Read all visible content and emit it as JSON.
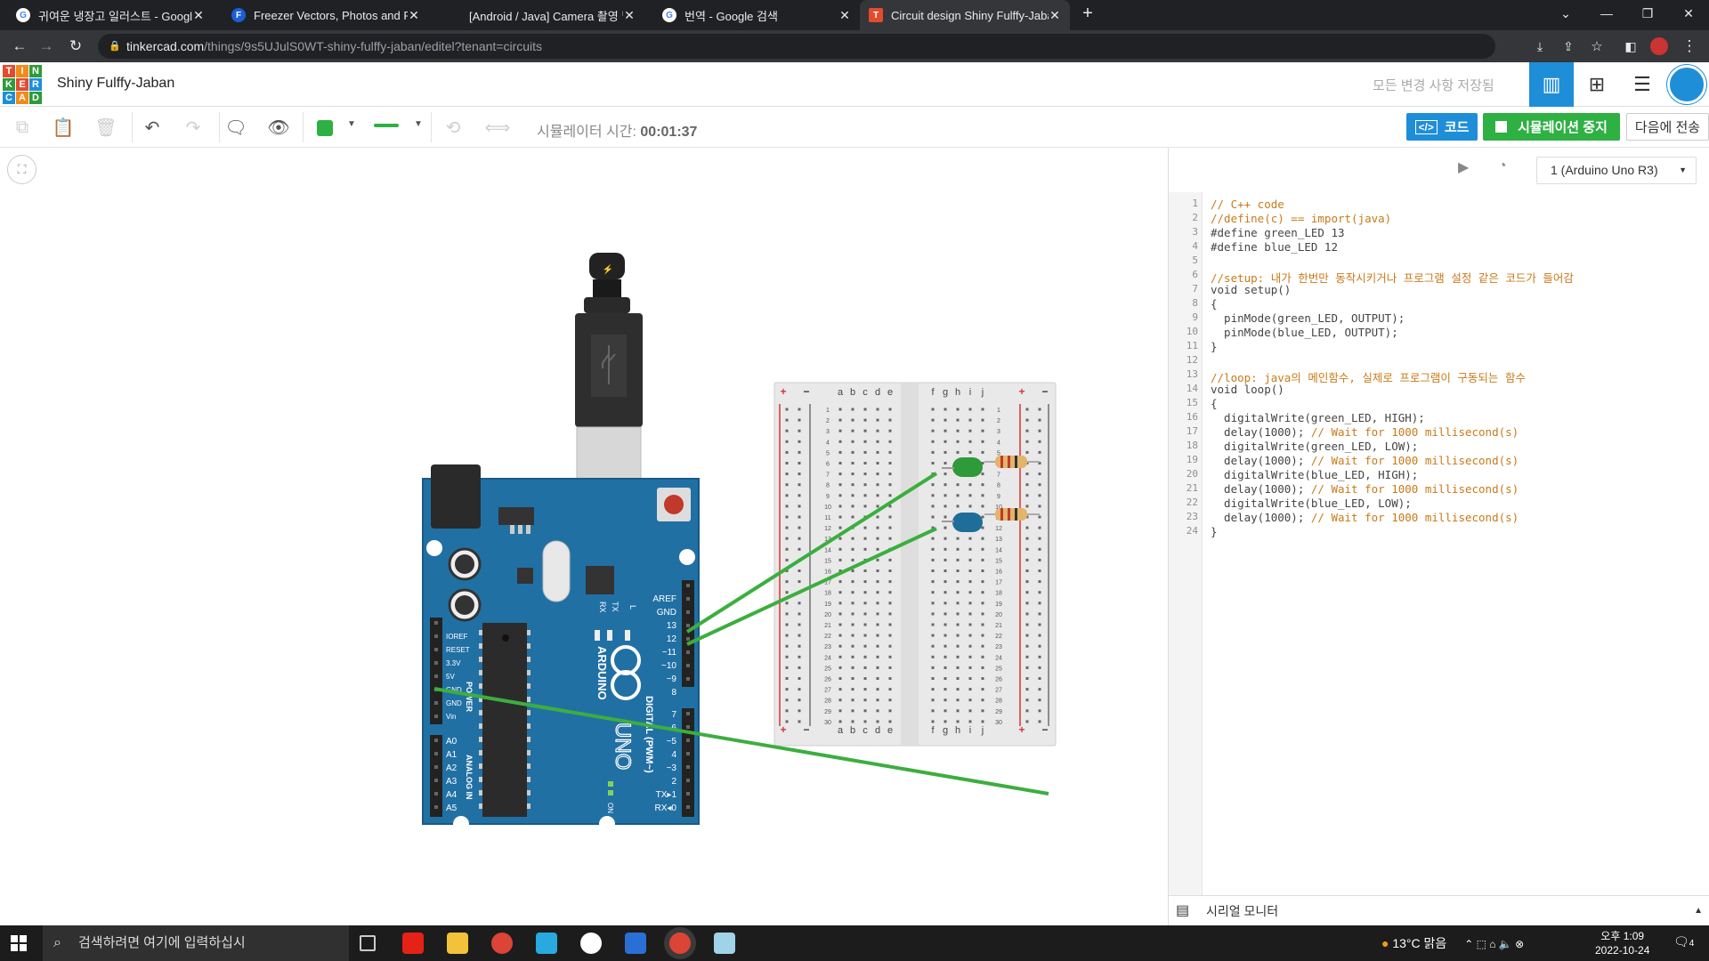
{
  "browser": {
    "tabs": [
      {
        "title": "귀여운 냉장고 일러스트 - Google",
        "icon": "google-icon",
        "active": false
      },
      {
        "title": "Freezer Vectors, Photos and PSD",
        "icon": "freepik-icon",
        "active": false
      },
      {
        "title": "[Android / Java] Camera 촬영 및",
        "icon": "blank-icon",
        "active": false
      },
      {
        "title": "번역 - Google 검색",
        "icon": "google-icon",
        "active": false
      },
      {
        "title": "Circuit design Shiny Fulffy-Jaban",
        "icon": "tinkercad-icon",
        "active": true
      }
    ],
    "url_host": "tinkercad.com",
    "url_path": "/things/9s5UJulS0WT-shiny-fulffy-jaban/editel?tenant=circuits"
  },
  "app": {
    "logo_letters": [
      "T",
      "I",
      "N",
      "K",
      "E",
      "R",
      "C",
      "A",
      "D"
    ],
    "design_name": "Shiny Fulffy-Jaban",
    "save_status": "모든 변경 사항 저장됨"
  },
  "toolbar": {
    "sim_time_label": "시뮬레이터 시간:",
    "sim_time_value": "00:01:37",
    "code_button": "코드",
    "stop_button": "시뮬레이션 중지",
    "send_button": "다음에 전송",
    "color_selected": "#2eb043"
  },
  "code_panel": {
    "device_select": "1 (Arduino Uno R3)",
    "serial_monitor": "시리얼 모니터",
    "lines": [
      "// C++ code",
      "//define(c) == import(java)",
      "#define green_LED 13",
      "#define blue_LED 12",
      "",
      "//setup: 내가 한번만 동작시키거나 프로그램 설정 같은 코드가 들어감",
      "void setup()",
      "{",
      "  pinMode(green_LED, OUTPUT);",
      "  pinMode(blue_LED, OUTPUT);",
      "}",
      "",
      "//loop: java의 메인함수, 실제로 프로그램이 구동되는 함수",
      "void loop()",
      "{",
      "  digitalWrite(green_LED, HIGH);",
      "  delay(1000); // Wait for 1000 millisecond(s)",
      "  digitalWrite(green_LED, LOW);",
      "  delay(1000); // Wait for 1000 millisecond(s)",
      "  digitalWrite(blue_LED, HIGH);",
      "  delay(1000); // Wait for 1000 millisecond(s)",
      "  digitalWrite(blue_LED, LOW);",
      "  delay(1000); // Wait for 1000 millisecond(s)",
      "}"
    ]
  },
  "circuit": {
    "board_brand": "ARDUINO",
    "board_model": "UNO",
    "digital_label": "DIGITAL (PWM~)",
    "power_label": "POWER",
    "analog_label": "ANALOG IN",
    "on_label": "ON",
    "tx_label": "TX",
    "rx_label": "RX",
    "l_label": "L",
    "digital_pins": [
      "AREF",
      "GND",
      "13",
      "12",
      "~11",
      "~10",
      "~9",
      "8",
      "7",
      "~6",
      "~5",
      "4",
      "~3",
      "2",
      "TX▸1",
      "RX◂0"
    ],
    "power_pins": [
      "IOREF",
      "RESET",
      "3.3V",
      "5V",
      "GND",
      "GND",
      "Vin"
    ],
    "analog_pins": [
      "A0",
      "A1",
      "A2",
      "A3",
      "A4",
      "A5"
    ],
    "breadboard_cols_left": [
      "a",
      "b",
      "c",
      "d",
      "e"
    ],
    "breadboard_cols_right": [
      "f",
      "g",
      "h",
      "i",
      "j"
    ],
    "breadboard_rows": 30,
    "plus": "+",
    "minus": "−",
    "led_green": "#2e9a3a",
    "led_blue": "#1f6d99",
    "wire_color": "#3cae3f"
  },
  "taskbar": {
    "search_placeholder": "검색하려면 여기에 입력하십시",
    "weather": "13°C 맑음",
    "time": "오후 1:09",
    "date": "2022-10-24",
    "notification_count": "4"
  }
}
